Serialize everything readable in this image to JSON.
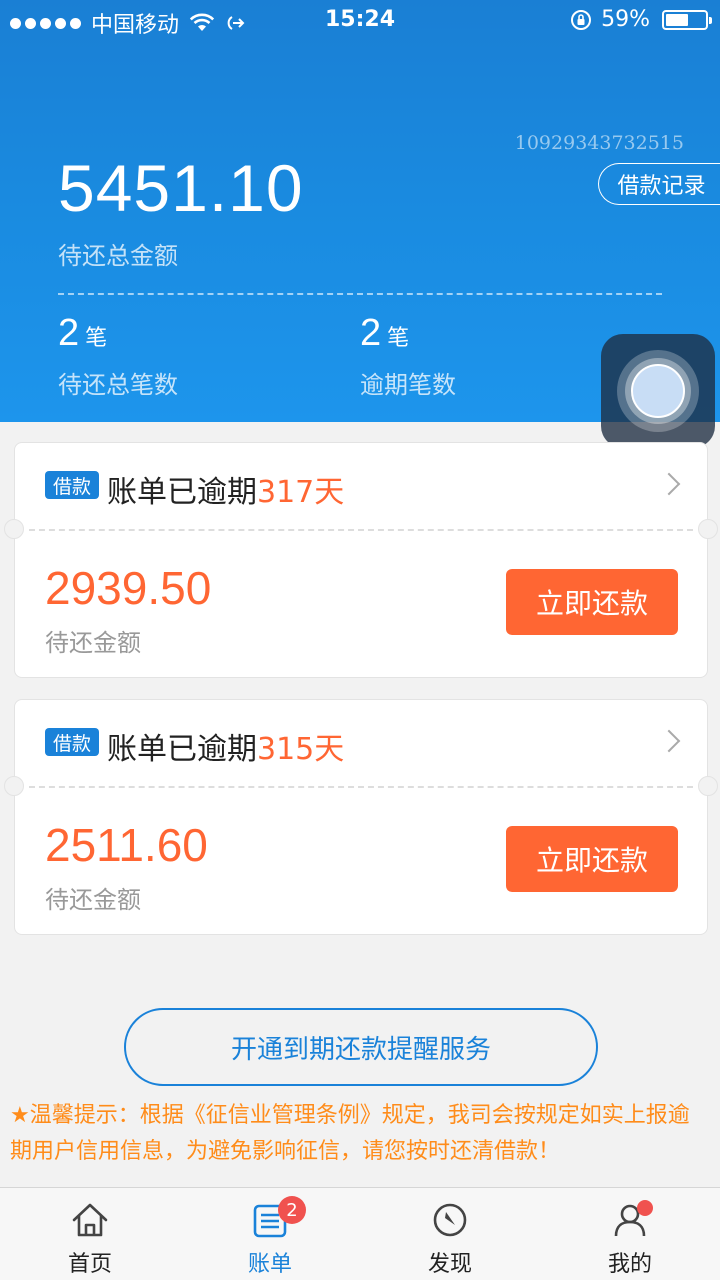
{
  "status_bar": {
    "carrier": "中国移动",
    "time": "15:24",
    "battery": "59%",
    "battery_level": 0.59
  },
  "header": {
    "account_number": "10929343732515",
    "loan_record_label": "借款记录",
    "total_amount": "5451.10",
    "total_amount_label": "待还总金额",
    "stats": [
      {
        "value": "2",
        "unit": "笔",
        "label": "待还总笔数"
      },
      {
        "value": "2",
        "unit": "笔",
        "label": "逾期笔数"
      }
    ]
  },
  "bills": [
    {
      "tag": "借款",
      "title_prefix": "账单已逾期",
      "overdue_days": "317天",
      "amount": "2939.50",
      "amount_label": "待还金额",
      "pay_label": "立即还款"
    },
    {
      "tag": "借款",
      "title_prefix": "账单已逾期",
      "overdue_days": "315天",
      "amount": "2511.60",
      "amount_label": "待还金额",
      "pay_label": "立即还款"
    }
  ],
  "reminder_button": "开通到期还款提醒服务",
  "notice": "★温馨提示：根据《征信业管理条例》规定，我司会按规定如实上报逾期用户信用信息，为避免影响征信，请您按时还清借款！",
  "tabbar": {
    "items": [
      {
        "label": "首页",
        "icon": "home-icon"
      },
      {
        "label": "账单",
        "icon": "bill-icon",
        "badge": "2"
      },
      {
        "label": "发现",
        "icon": "compass-icon"
      },
      {
        "label": "我的",
        "icon": "user-icon"
      }
    ],
    "active_index": 1
  },
  "colors": {
    "brand_blue": "#1a82d9",
    "accent_orange": "#ff6633",
    "notice_orange": "#ff8c1a",
    "badge_red": "#f0524f"
  }
}
